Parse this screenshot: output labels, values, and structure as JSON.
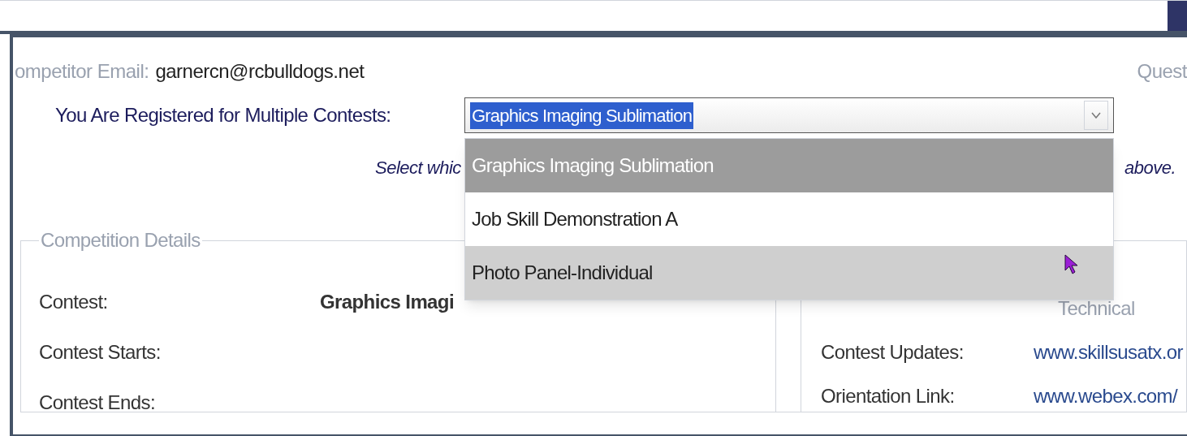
{
  "competitor_email": {
    "label": "ompetitor Email:",
    "value": "garnercn@rcbulldogs.net"
  },
  "questions_label": "Quest",
  "contest_select": {
    "label": "You Are Registered for Multiple Contests:",
    "value": "Graphics Imaging Sublimation",
    "expanded": true,
    "options": [
      {
        "label": "Graphics Imaging Sublimation",
        "selected": true,
        "hovered": false
      },
      {
        "label": "Job Skill Demonstration A",
        "selected": false,
        "hovered": false
      },
      {
        "label": "Photo Panel-Individual",
        "selected": false,
        "hovered": true
      }
    ]
  },
  "instruction": {
    "start": "Select whic",
    "end": "above."
  },
  "competition_details": {
    "legend": "Competition Details",
    "rows": [
      {
        "label": "Contest:",
        "value": "Graphics Imagi"
      },
      {
        "label": "Contest Starts:",
        "value": ""
      },
      {
        "label": "Contest Ends:",
        "value": ""
      }
    ],
    "right_rows": [
      {
        "label": "",
        "value": "Technical",
        "kind": "text"
      },
      {
        "label": "Contest Updates:",
        "value": "www.skillsusatx.or",
        "kind": "link"
      },
      {
        "label": "Orientation Link:",
        "value": "www.webex.com/",
        "kind": "link"
      }
    ]
  }
}
